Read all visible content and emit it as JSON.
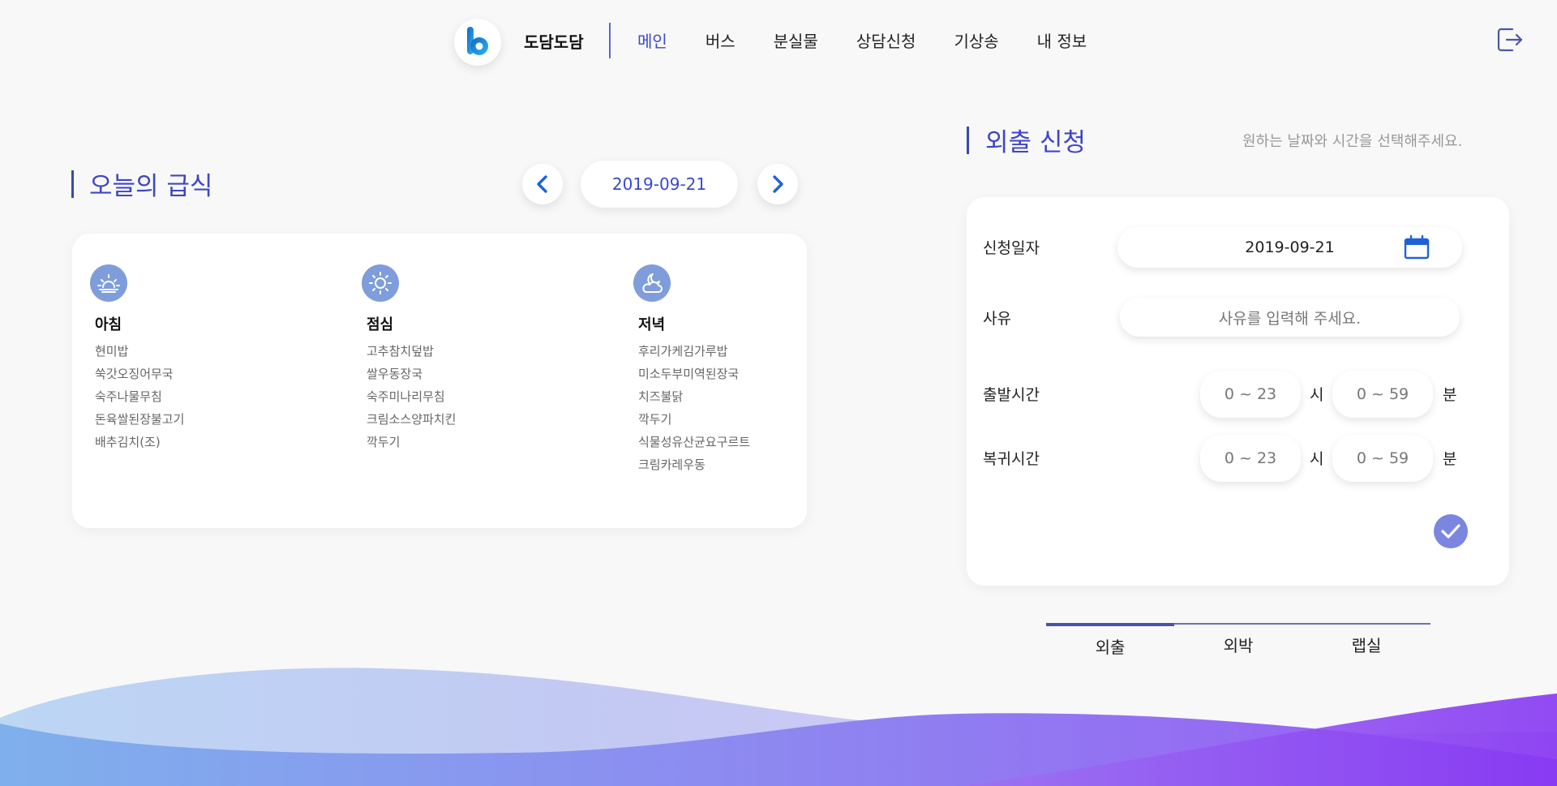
{
  "header": {
    "brand": "도담도담",
    "nav": [
      {
        "label": "메인",
        "active": true
      },
      {
        "label": "버스",
        "active": false
      },
      {
        "label": "분실물",
        "active": false
      },
      {
        "label": "상담신청",
        "active": false
      },
      {
        "label": "기상송",
        "active": false
      },
      {
        "label": "내 정보",
        "active": false
      }
    ],
    "logo_icon": "b-logo-icon",
    "logout_icon": "logout-icon"
  },
  "meal": {
    "title": "오늘의 급식",
    "date": "2019-09-21",
    "prev_icon": "chevron-left-icon",
    "next_icon": "chevron-right-icon",
    "columns": [
      {
        "name": "아침",
        "icon": "sunrise-icon",
        "items": [
          "현미밥",
          "쑥갓오징어무국",
          "숙주나물무침",
          "돈육쌀된장불고기",
          "배추김치(조)"
        ]
      },
      {
        "name": "점심",
        "icon": "sun-icon",
        "items": [
          "고추참치덮밥",
          "쌀우동장국",
          "숙주미나리무침",
          "크림소스양파치킨",
          "깍두기"
        ]
      },
      {
        "name": "저녁",
        "icon": "moon-cloud-icon",
        "items": [
          "후리가케김가루밥",
          "미소두부미역된장국",
          "치즈불닭",
          "깍두기",
          "식물성유산균요구르트",
          "크림카레우동"
        ]
      }
    ]
  },
  "outing": {
    "title": "외출 신청",
    "hint": "원하는 날짜와 시간을 선택해주세요.",
    "fields": {
      "date_label": "신청일자",
      "date_value": "2019-09-21",
      "reason_label": "사유",
      "reason_placeholder": "사유를 입력해 주세요.",
      "depart_label": "출발시간",
      "return_label": "복귀시간",
      "hour_placeholder": "0 ~ 23",
      "minute_placeholder": "0 ~ 59",
      "hour_unit": "시",
      "minute_unit": "분"
    },
    "tabs": [
      {
        "label": "외출",
        "active": true
      },
      {
        "label": "외박",
        "active": false
      },
      {
        "label": "랩실",
        "active": false
      }
    ]
  },
  "colors": {
    "accent": "#3f46c4",
    "date_text": "#3949c8",
    "meal_icon_bg": "#7f9ddb",
    "submit_bg": "#7a86e0",
    "background": "#f8f8f8"
  }
}
